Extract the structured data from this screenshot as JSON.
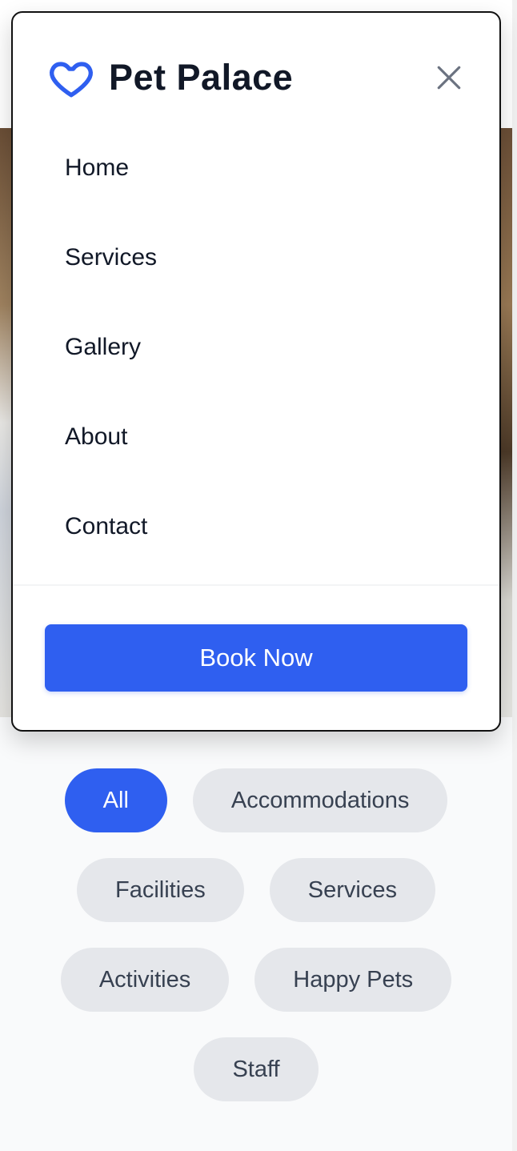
{
  "brand": {
    "name": "Pet Palace",
    "icon": "heart-icon",
    "accent": "#2f5ff0"
  },
  "menu": {
    "close_icon": "close-icon",
    "items": [
      {
        "label": "Home"
      },
      {
        "label": "Services"
      },
      {
        "label": "Gallery"
      },
      {
        "label": "About"
      },
      {
        "label": "Contact"
      }
    ],
    "cta_label": "Book Now"
  },
  "gallery_filters": {
    "active": "All",
    "items": [
      {
        "label": "All"
      },
      {
        "label": "Accommodations"
      },
      {
        "label": "Facilities"
      },
      {
        "label": "Services"
      },
      {
        "label": "Activities"
      },
      {
        "label": "Happy Pets"
      },
      {
        "label": "Staff"
      }
    ]
  }
}
